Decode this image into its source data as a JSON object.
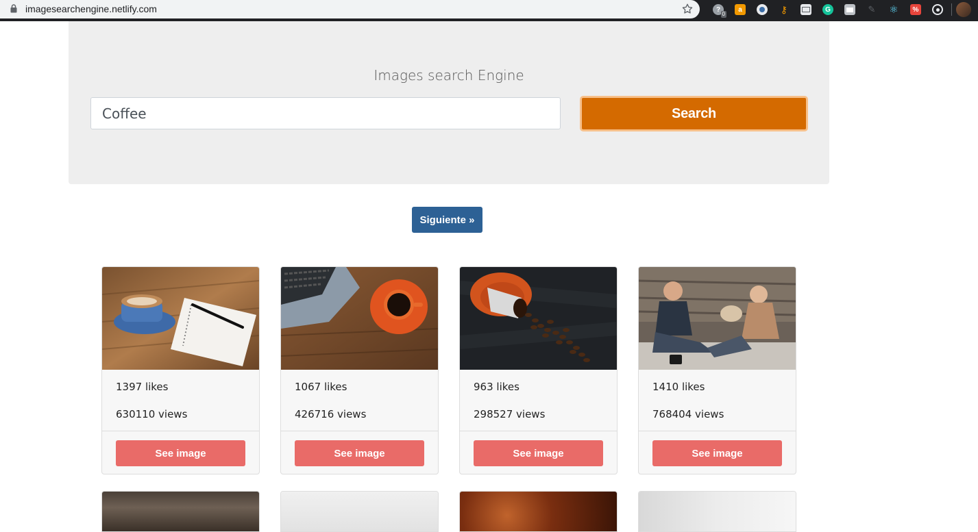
{
  "browser": {
    "url": "imagesearchengine.netlify.com",
    "extension_badge": "0"
  },
  "header": {
    "title": "Images search Engine",
    "search_value": "Coffee",
    "search_label": "Search"
  },
  "pagination": {
    "next_label": "Siguiente »"
  },
  "results": [
    {
      "likes": "1397 likes",
      "views": "630110 views",
      "button": "See image",
      "image": "coffee-cup-notebook"
    },
    {
      "likes": "1067 likes",
      "views": "426716 views",
      "button": "See image",
      "image": "laptop-coffee-cup"
    },
    {
      "likes": "963 likes",
      "views": "298527 views",
      "button": "See image",
      "image": "spilled-coffee-beans"
    },
    {
      "likes": "1410 likes",
      "views": "768404 views",
      "button": "See image",
      "image": "couple-with-coffee"
    }
  ],
  "colors": {
    "search_button": "#d46a00",
    "next_button": "#2d6195",
    "see_image_button": "#e96b68",
    "jumbotron": "#eeeeee"
  }
}
